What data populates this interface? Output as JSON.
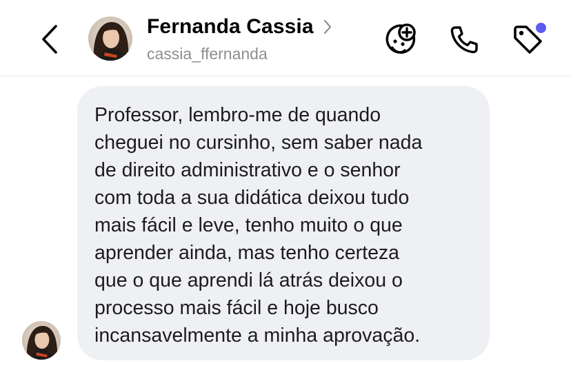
{
  "header": {
    "back_icon": "chevron-left-icon",
    "contact_name": "Fernanda Cassia",
    "contact_username": "cassia_ffernanda",
    "name_chevron_icon": "chevron-right-icon",
    "actions": {
      "sticker_icon": "sticker-add-icon",
      "call_icon": "phone-icon",
      "tag_icon": "tag-icon",
      "notification_color": "#5b5bf0"
    }
  },
  "conversation": {
    "messages": [
      {
        "text": "Professor, lembro-me de quando\ncheguei no cursinho, sem saber nada\nde direito administrativo e o senhor\ncom toda a sua didática deixou tudo\nmais fácil e leve, tenho muito o que\naprender ainda, mas tenho certeza\nque o que aprendi lá atrás deixou o\nprocesso mais fácil e hoje busco\nincansavelmente a minha aprovação.",
        "bubble_color": "#eff0f4"
      }
    ]
  },
  "colors": {
    "background": "#ffffff",
    "username": "#8e8e93",
    "divider": "#e8e8ea"
  }
}
